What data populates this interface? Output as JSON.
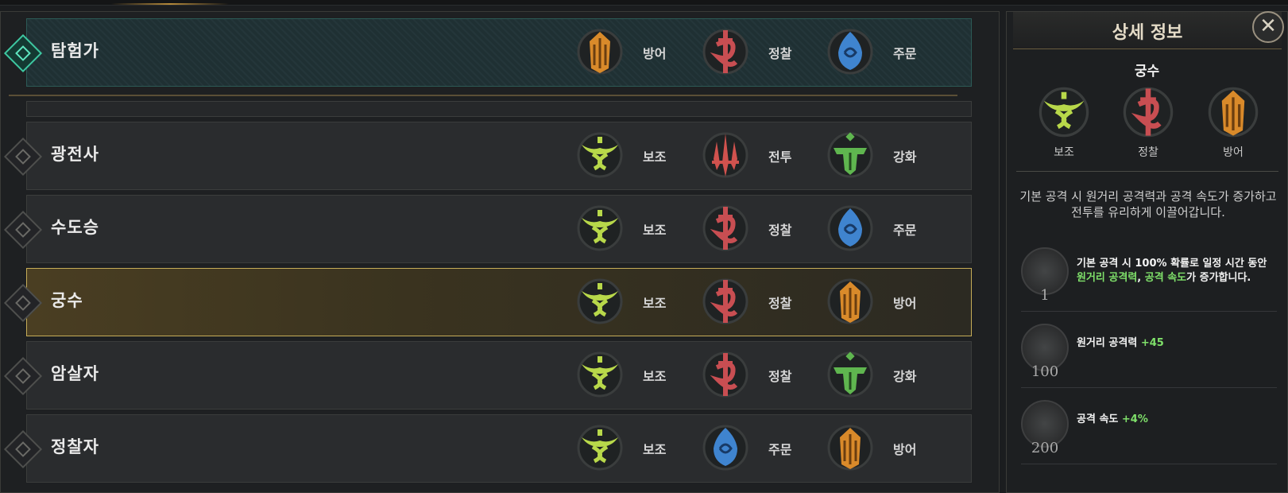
{
  "classes": [
    {
      "name": "탐험가",
      "roles": [
        {
          "icon": "defense-icon",
          "label": "방어"
        },
        {
          "icon": "recon-icon",
          "label": "정찰"
        },
        {
          "icon": "spell-icon",
          "label": "주문"
        }
      ]
    },
    {
      "name": "광전사",
      "roles": [
        {
          "icon": "support-icon",
          "label": "보조"
        },
        {
          "icon": "combat-icon",
          "label": "전투"
        },
        {
          "icon": "enhance-icon",
          "label": "강화"
        }
      ]
    },
    {
      "name": "수도승",
      "roles": [
        {
          "icon": "support-icon",
          "label": "보조"
        },
        {
          "icon": "recon-icon",
          "label": "정찰"
        },
        {
          "icon": "spell-icon",
          "label": "주문"
        }
      ]
    },
    {
      "name": "궁수",
      "roles": [
        {
          "icon": "support-icon",
          "label": "보조"
        },
        {
          "icon": "recon-icon",
          "label": "정찰"
        },
        {
          "icon": "defense-icon",
          "label": "방어"
        }
      ]
    },
    {
      "name": "암살자",
      "roles": [
        {
          "icon": "support-icon",
          "label": "보조"
        },
        {
          "icon": "recon-icon",
          "label": "정찰"
        },
        {
          "icon": "enhance-icon",
          "label": "강화"
        }
      ]
    },
    {
      "name": "정찰자",
      "roles": [
        {
          "icon": "support-icon",
          "label": "보조"
        },
        {
          "icon": "spell-icon",
          "label": "주문"
        },
        {
          "icon": "defense-icon",
          "label": "방어"
        }
      ]
    }
  ],
  "detail": {
    "title": "상세 정보",
    "close": "✕",
    "class_name": "궁수",
    "roles": [
      {
        "icon": "support-icon",
        "label": "보조"
      },
      {
        "icon": "recon-icon",
        "label": "정찰"
      },
      {
        "icon": "defense-icon",
        "label": "방어"
      }
    ],
    "description_line1": "기본 공격 시 원거리 공격력과 공격 속도가 증가하고",
    "description_line2": "전투를 유리하게 이끌어갑니다.",
    "effects": [
      {
        "level": "1",
        "line1": "기본 공격 시 100% 확률로 일정 시간 동안",
        "hl1": "원거리 공격력",
        "sep": ", ",
        "hl2": "공격 속도",
        "tail": "가 증가합니다."
      },
      {
        "level": "100",
        "text": "원거리 공격력 ",
        "value": "+45"
      },
      {
        "level": "200",
        "text": "공격 속도 ",
        "value": "+4%"
      }
    ]
  },
  "colors": {
    "support": "#b8d84a",
    "recon": "#c84e52",
    "spell": "#3f84cf",
    "defense": "#d98a2a",
    "enhance": "#5fb64f",
    "combat": "#d0524e",
    "selected_border": "#c6ad58",
    "explorer_border": "#3ec7a1"
  }
}
